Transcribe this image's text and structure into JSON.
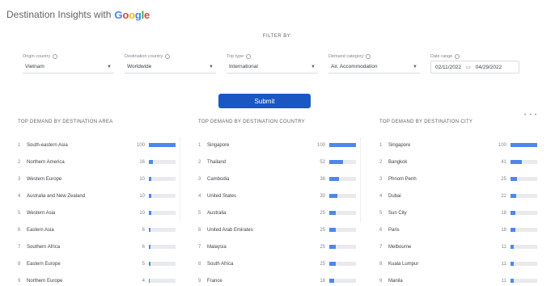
{
  "header": {
    "title": "Destination Insights with",
    "logo_letters": [
      "G",
      "o",
      "o",
      "g",
      "l",
      "e"
    ]
  },
  "filter_by_label": "FILTER BY:",
  "filters": [
    {
      "label": "Origin country",
      "value": "Vietnam"
    },
    {
      "label": "Destination country",
      "value": "Worldwide"
    },
    {
      "label": "Trip type",
      "value": "International"
    },
    {
      "label": "Demand category",
      "value": "Air, Accommodation"
    },
    {
      "label": "Date range",
      "start": "02/11/2022",
      "end": "04/29/2022"
    }
  ],
  "submit_label": "Submit",
  "more_icon": "more-dots-icon",
  "panels": [
    {
      "title": "TOP DEMAND BY DESTINATION AREA",
      "rows": [
        {
          "rank": "1",
          "name": "South-eastern Asia",
          "value": 100
        },
        {
          "rank": "2",
          "name": "Northern America",
          "value": 16
        },
        {
          "rank": "3",
          "name": "Western Europe",
          "value": 10
        },
        {
          "rank": "4",
          "name": "Australia and New Zealand",
          "value": 10
        },
        {
          "rank": "5",
          "name": "Western Asia",
          "value": 10
        },
        {
          "rank": "6",
          "name": "Eastern Asia",
          "value": 6
        },
        {
          "rank": "7",
          "name": "Southern Africa",
          "value": 6
        },
        {
          "rank": "8",
          "name": "Eastern Europe",
          "value": 5
        },
        {
          "rank": "9",
          "name": "Northern Europe",
          "value": 4
        }
      ]
    },
    {
      "title": "TOP DEMAND BY DESTINATION COUNTRY",
      "rows": [
        {
          "rank": "1",
          "name": "Singapore",
          "value": 100
        },
        {
          "rank": "2",
          "name": "Thailand",
          "value": 52
        },
        {
          "rank": "3",
          "name": "Cambodia",
          "value": 36
        },
        {
          "rank": "4",
          "name": "United States",
          "value": 30
        },
        {
          "rank": "5",
          "name": "Australia",
          "value": 25
        },
        {
          "rank": "6",
          "name": "United Arab Emirates",
          "value": 25
        },
        {
          "rank": "7",
          "name": "Malaysia",
          "value": 25
        },
        {
          "rank": "8",
          "name": "South Africa",
          "value": 25
        },
        {
          "rank": "9",
          "name": "France",
          "value": 18
        }
      ]
    },
    {
      "title": "TOP DEMAND BY DESTINATION CITY",
      "rows": [
        {
          "rank": "1",
          "name": "Singapore",
          "value": 100
        },
        {
          "rank": "2",
          "name": "Bangkok",
          "value": 41
        },
        {
          "rank": "3",
          "name": "Phnom Penh",
          "value": 25
        },
        {
          "rank": "4",
          "name": "Dubai",
          "value": 22
        },
        {
          "rank": "5",
          "name": "Sun City",
          "value": 18
        },
        {
          "rank": "6",
          "name": "Paris",
          "value": 18
        },
        {
          "rank": "7",
          "name": "Melbourne",
          "value": 11
        },
        {
          "rank": "8",
          "name": "Kuala Lumpur",
          "value": 11
        },
        {
          "rank": "9",
          "name": "Manila",
          "value": 11
        }
      ]
    }
  ]
}
